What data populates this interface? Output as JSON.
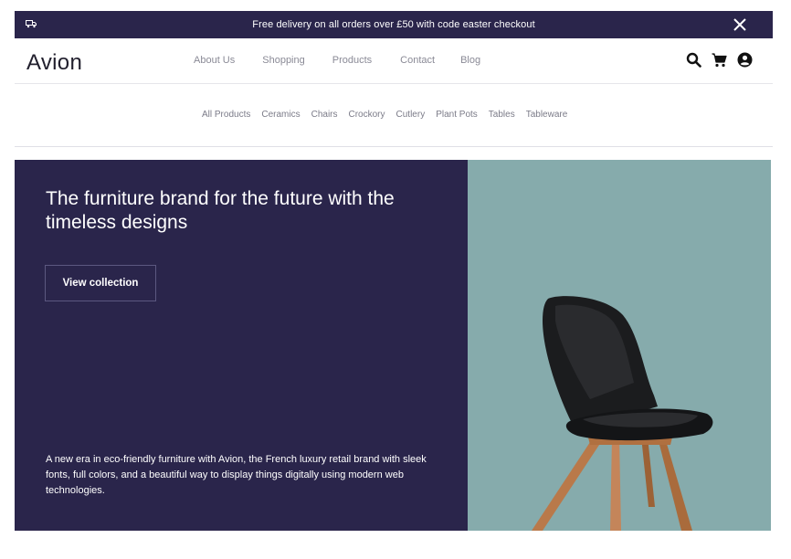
{
  "promo": {
    "icon": "truck-icon",
    "text": "Free delivery on all orders over £50 with code easter checkout",
    "close_icon": "close-icon"
  },
  "header": {
    "logo": "Avion",
    "nav": [
      "About Us",
      "Shopping",
      "Products",
      "Contact",
      "Blog"
    ],
    "icons": [
      "search-icon",
      "cart-icon",
      "user-icon"
    ]
  },
  "categories": [
    "All Products",
    "Ceramics",
    "Chairs",
    "Crockory",
    "Cutlery",
    "Plant Pots",
    "Tables",
    "Tableware"
  ],
  "hero": {
    "title": "The furniture brand for the future with the timeless designs",
    "button_label": "View collection",
    "description": "A new era in eco-friendly furniture with Avion, the French luxury retail brand with sleek fonts, full colors, and a beautiful way to display things digitally using modern web technologies.",
    "image": "chair-image"
  },
  "colors": {
    "dark": "#2a254b",
    "hero_right_bg": "#86abac",
    "nav_text": "#8a8a96"
  }
}
